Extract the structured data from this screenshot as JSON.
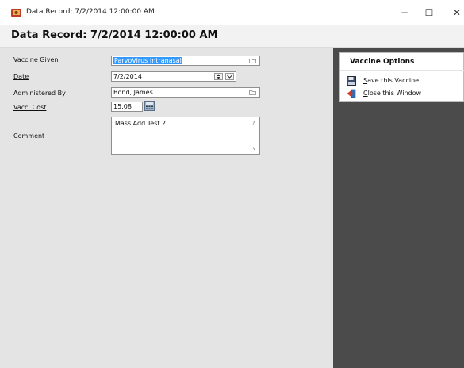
{
  "window": {
    "title": "Data Record: 7/2/2014 12:00:00 AM",
    "controls": {
      "minimize": "−",
      "maximize": "☐",
      "close": "✕"
    }
  },
  "header": {
    "title": "Data Record: 7/2/2014 12:00:00 AM"
  },
  "form": {
    "vaccine_given": {
      "label": "Vaccine Given",
      "value": "ParvoVirus Intranasal"
    },
    "date": {
      "label": "Date",
      "value": "7/2/2014"
    },
    "administered_by": {
      "label": "Administered By",
      "value": "Bond, James"
    },
    "cost": {
      "label": "Vacc. Cost",
      "value": "15.08"
    },
    "comment": {
      "label": "Comment",
      "value": "Mass Add Test 2"
    }
  },
  "options": {
    "title": "Vaccine Options",
    "save": {
      "hotkey": "S",
      "rest": "ave this Vaccine"
    },
    "close": {
      "hotkey": "C",
      "rest": "lose this Window"
    }
  },
  "colors": {
    "selection": "#3399ff",
    "side_panel": "#4b4b4b",
    "form_bg": "#e4e4e4"
  }
}
